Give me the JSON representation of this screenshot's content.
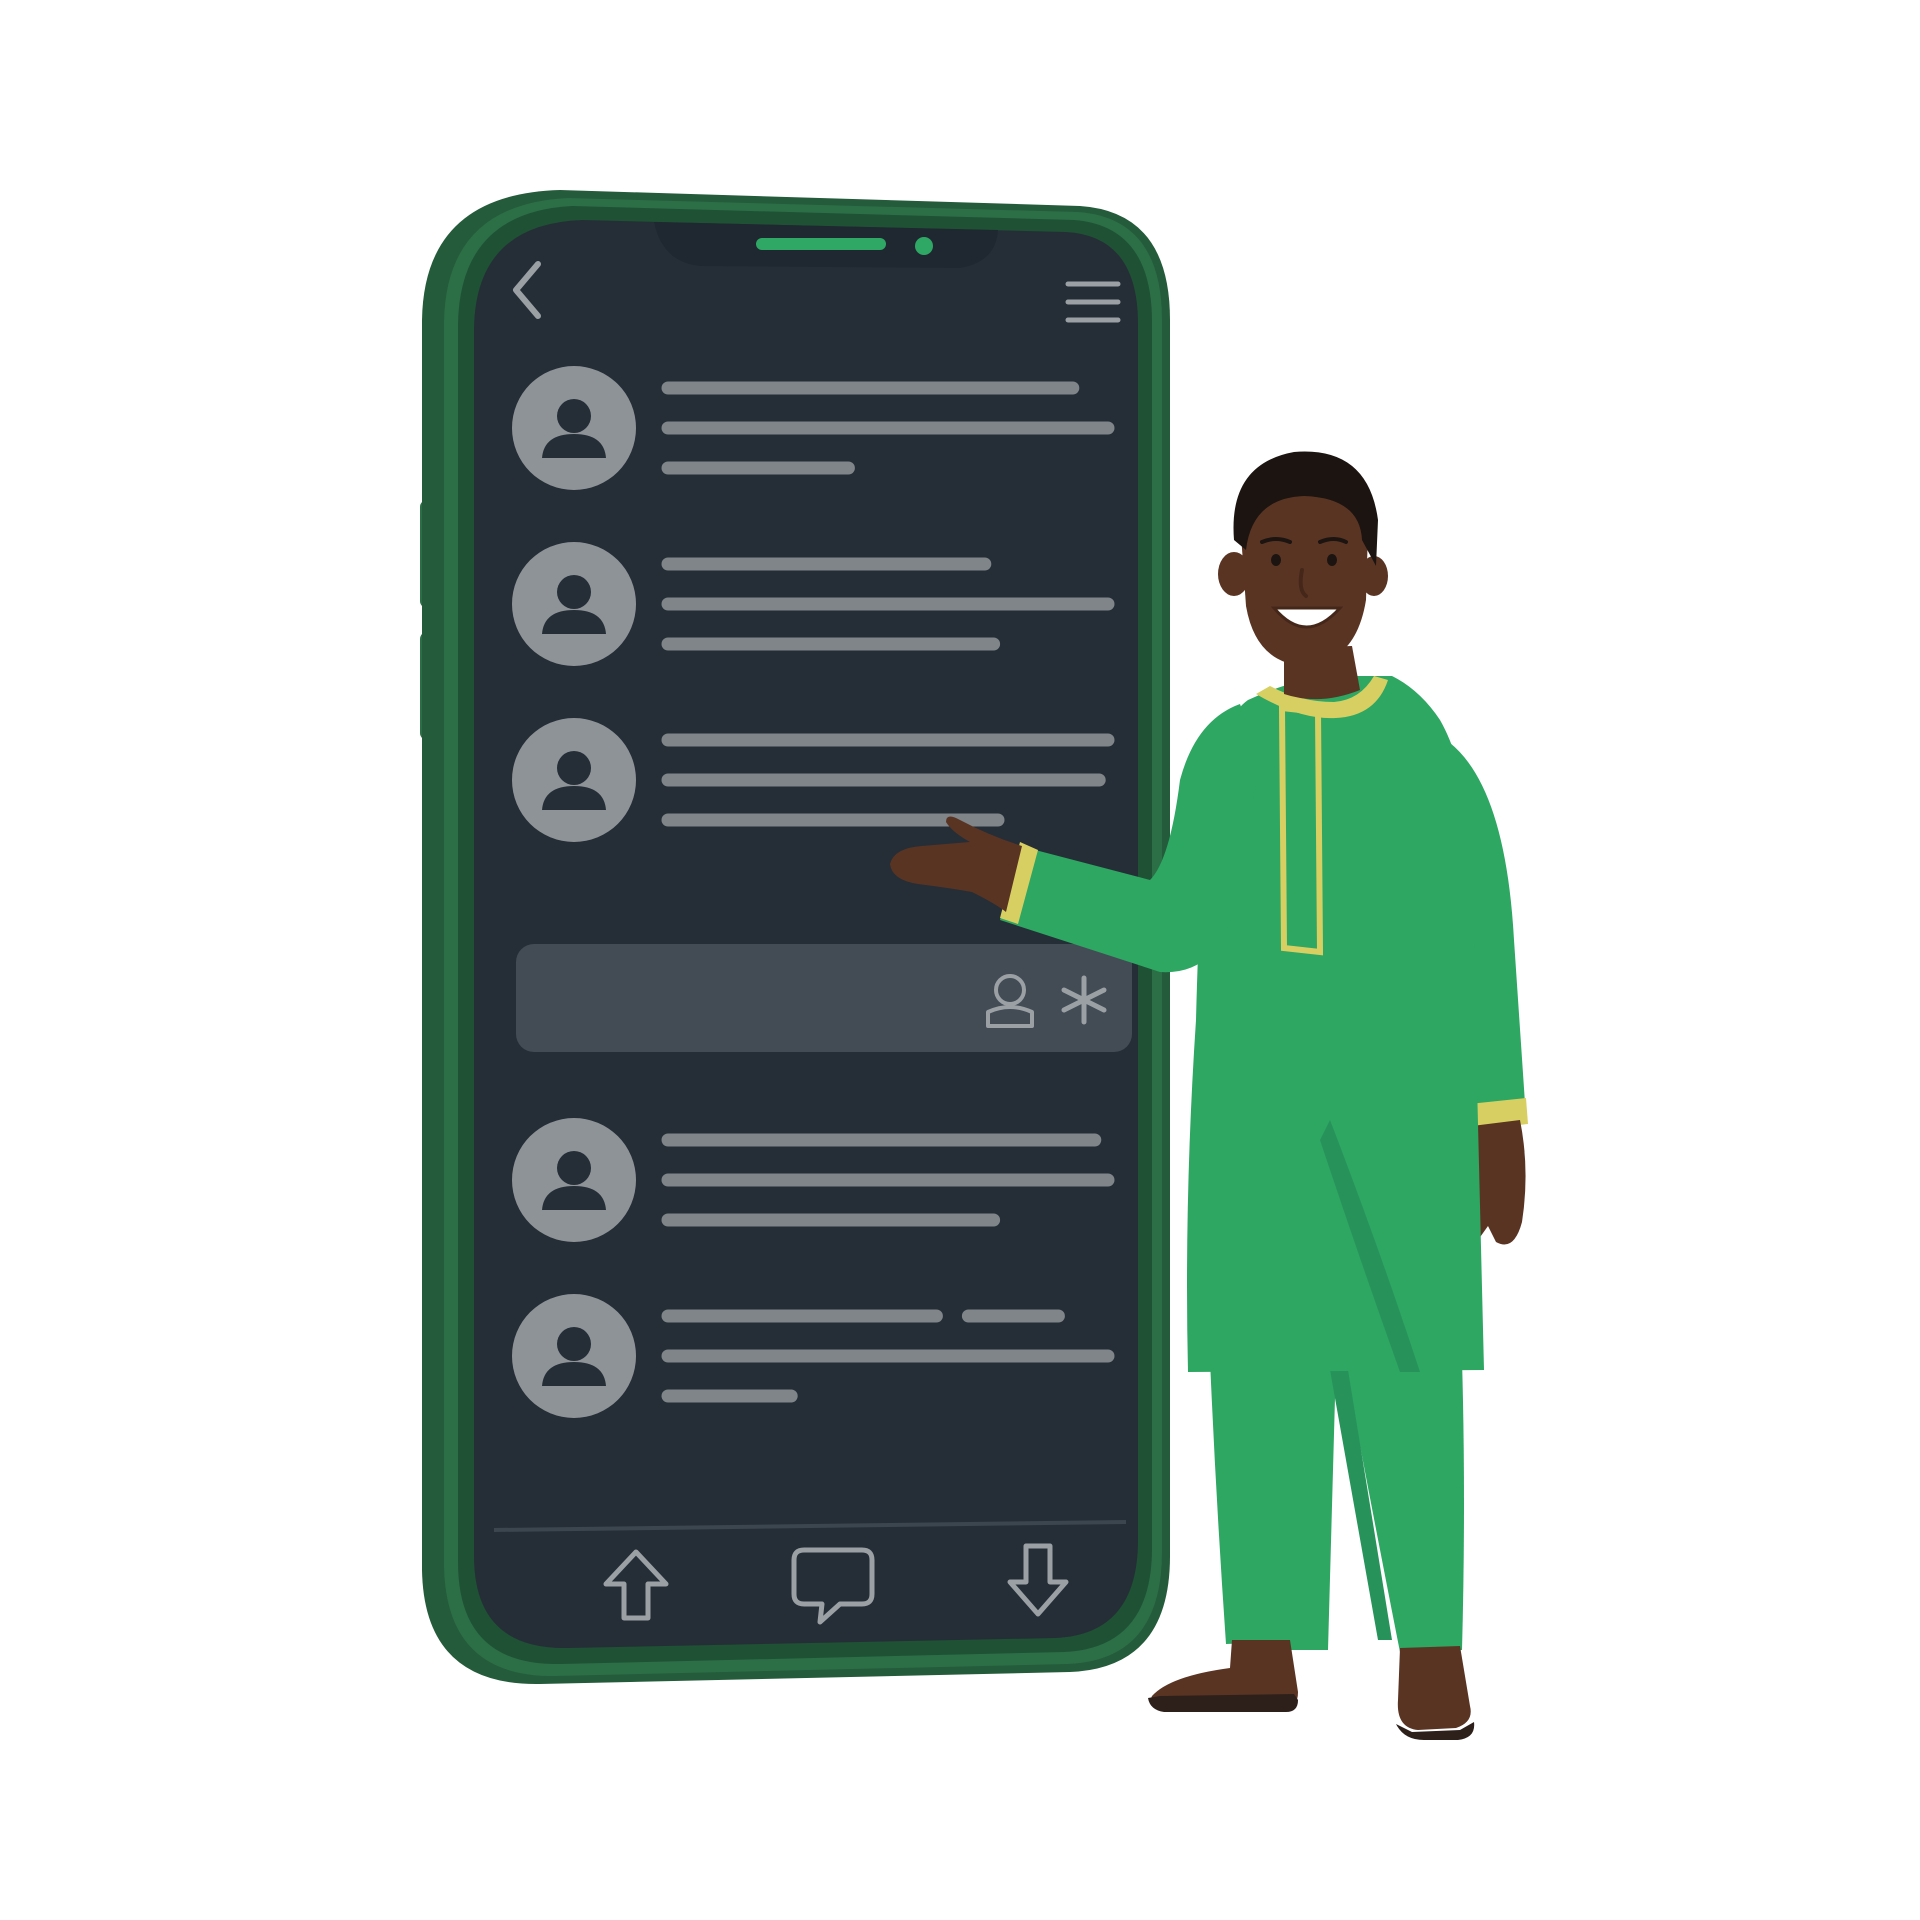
{
  "colors": {
    "background": "#ffffff",
    "phone_frame": "#2c6e45",
    "phone_frame_dark": "#1f5134",
    "phone_frame_light": "#3a8a57",
    "phone_edge": "#245b3a",
    "screen": "#252e36",
    "skeleton": "#7f8589",
    "avatar_circle": "#8e9397",
    "avatar_figure": "#252e36",
    "icon_stroke": "#9aa0a4",
    "search_bar": "#434c55",
    "accent_green": "#2fa866",
    "speaker_green": "#2fa866",
    "kaftan_green": "#2ea762",
    "kaftan_shadow": "#27935a",
    "trim_yellow": "#d8cf63",
    "skin": "#5a3423",
    "skin_shadow": "#45271a",
    "hair": "#1b1410",
    "shoe": "#2d201b"
  },
  "screen": {
    "header": {
      "back_icon": "chevron-left-icon",
      "menu_icon": "hamburger-menu-icon"
    },
    "list_items": [
      {
        "avatar_icon": "user-avatar-icon",
        "line_lengths": [
          0.92,
          1.0,
          0.41
        ]
      },
      {
        "avatar_icon": "user-avatar-icon",
        "line_lengths": [
          0.72,
          1.0,
          0.74
        ]
      },
      {
        "avatar_icon": "user-avatar-icon",
        "line_lengths": [
          1.0,
          0.98,
          0.75
        ]
      },
      {
        "avatar_icon": "user-avatar-icon",
        "line_lengths": [
          0.97,
          1.0,
          0.74
        ]
      },
      {
        "avatar_icon": "user-avatar-icon",
        "line_lengths": [
          0.61,
          1.0,
          0.28
        ],
        "extra_segment": true
      }
    ],
    "search_bar": {
      "icons": [
        "user-outline-icon",
        "star-icon"
      ]
    },
    "bottom_nav": {
      "icons": [
        "arrow-up-icon",
        "chat-bubble-icon",
        "arrow-down-icon"
      ]
    }
  }
}
